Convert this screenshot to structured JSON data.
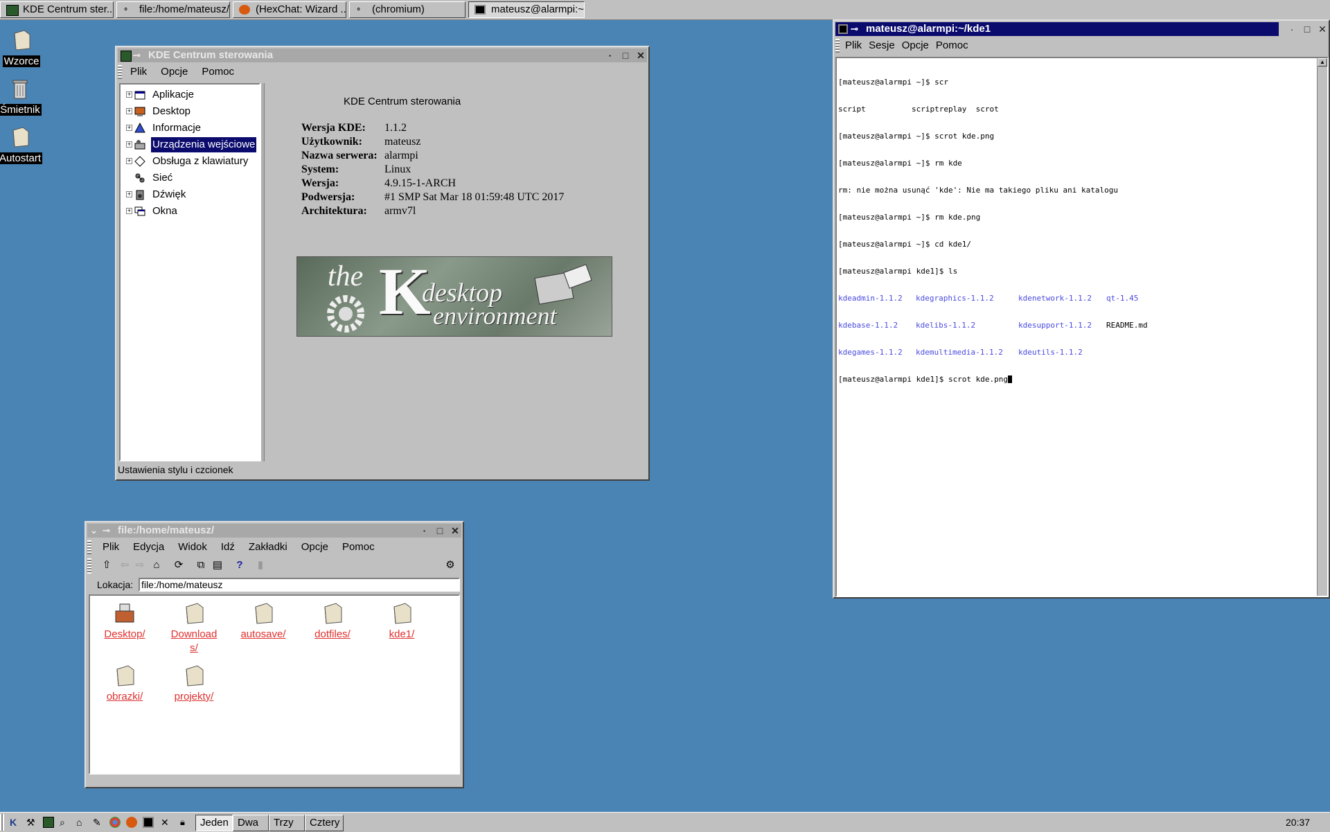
{
  "taskbar": {
    "tasks": [
      {
        "label": "KDE Centrum ster..."
      },
      {
        "label": "file:/home/mateusz/"
      },
      {
        "label": "(HexChat: Wizard ..."
      },
      {
        "label": "(chromium)"
      },
      {
        "label": "mateusz@alarmpi:~/..."
      }
    ]
  },
  "desktop_icons": [
    {
      "label": "Wzorce"
    },
    {
      "label": "Śmietnik"
    },
    {
      "label": "Autostart"
    }
  ],
  "control_center": {
    "title": "KDE Centrum sterowania",
    "menu": [
      "Plik",
      "Opcje",
      "Pomoc"
    ],
    "tree": [
      "Aplikacje",
      "Desktop",
      "Informacje",
      "Urządzenia wejściowe",
      "Obsługa z klawiatury",
      "Sieć",
      "Dźwięk",
      "Okna"
    ],
    "heading": "KDE Centrum sterowania",
    "info": [
      {
        "k": "Wersja KDE:",
        "v": "1.1.2"
      },
      {
        "k": "Użytkownik:",
        "v": "mateusz"
      },
      {
        "k": "Nazwa serwera:",
        "v": "alarmpi"
      },
      {
        "k": "System:",
        "v": "Linux"
      },
      {
        "k": "Wersja:",
        "v": "4.9.15-1-ARCH"
      },
      {
        "k": "Podwersja:",
        "v": "#1 SMP Sat Mar 18 01:59:48 UTC 2017"
      },
      {
        "k": "Architektura:",
        "v": "armv7l"
      }
    ],
    "logo": {
      "the": "the",
      "k": "K",
      "desktop": "desktop",
      "environment": "environment"
    },
    "status": "Ustawienia stylu i czcionek"
  },
  "file_manager": {
    "title": "file:/home/mateusz/",
    "menu": [
      "Plik",
      "Edycja",
      "Widok",
      "Idź",
      "Zakładki",
      "Opcje",
      "Pomoc"
    ],
    "location_label": "Lokacja:",
    "location_value": "file:/home/mateusz",
    "items": [
      {
        "label": "Desktop/"
      },
      {
        "label": "Downloads/"
      },
      {
        "label": "autosave/"
      },
      {
        "label": "dotfiles/"
      },
      {
        "label": "kde1/"
      },
      {
        "label": "obrazki/"
      },
      {
        "label": "projekty/"
      }
    ]
  },
  "terminal": {
    "title": "mateusz@alarmpi:~/kde1",
    "menu": [
      "Plik",
      "Sesje",
      "Opcje",
      "Pomoc"
    ],
    "lines": [
      "[mateusz@alarmpi ~]$ scr",
      "script          scriptreplay  scrot",
      "[mateusz@alarmpi ~]$ scrot kde.png",
      "[mateusz@alarmpi ~]$ rm kde",
      "rm: nie można usunąć 'kde': Nie ma takiego pliku ani katalogu",
      "[mateusz@alarmpi ~]$ rm kde.png",
      "[mateusz@alarmpi ~]$ cd kde1/",
      "[mateusz@alarmpi kde1]$ ls"
    ],
    "ls": [
      [
        "kdeadmin-1.1.2",
        "kdegraphics-1.1.2",
        "kdenetwork-1.1.2",
        "qt-1.45"
      ],
      [
        "kdebase-1.1.2",
        "kdelibs-1.1.2",
        "kdesupport-1.1.2",
        "README.md"
      ],
      [
        "kdegames-1.1.2",
        "kdemultimedia-1.1.2",
        "kdeutils-1.1.2",
        ""
      ]
    ],
    "prompt": "[mateusz@alarmpi kde1]$ scrot kde.png"
  },
  "panel": {
    "desktops": [
      "Jeden",
      "Dwa",
      "Trzy",
      "Cztery"
    ],
    "clock": "20:37"
  }
}
